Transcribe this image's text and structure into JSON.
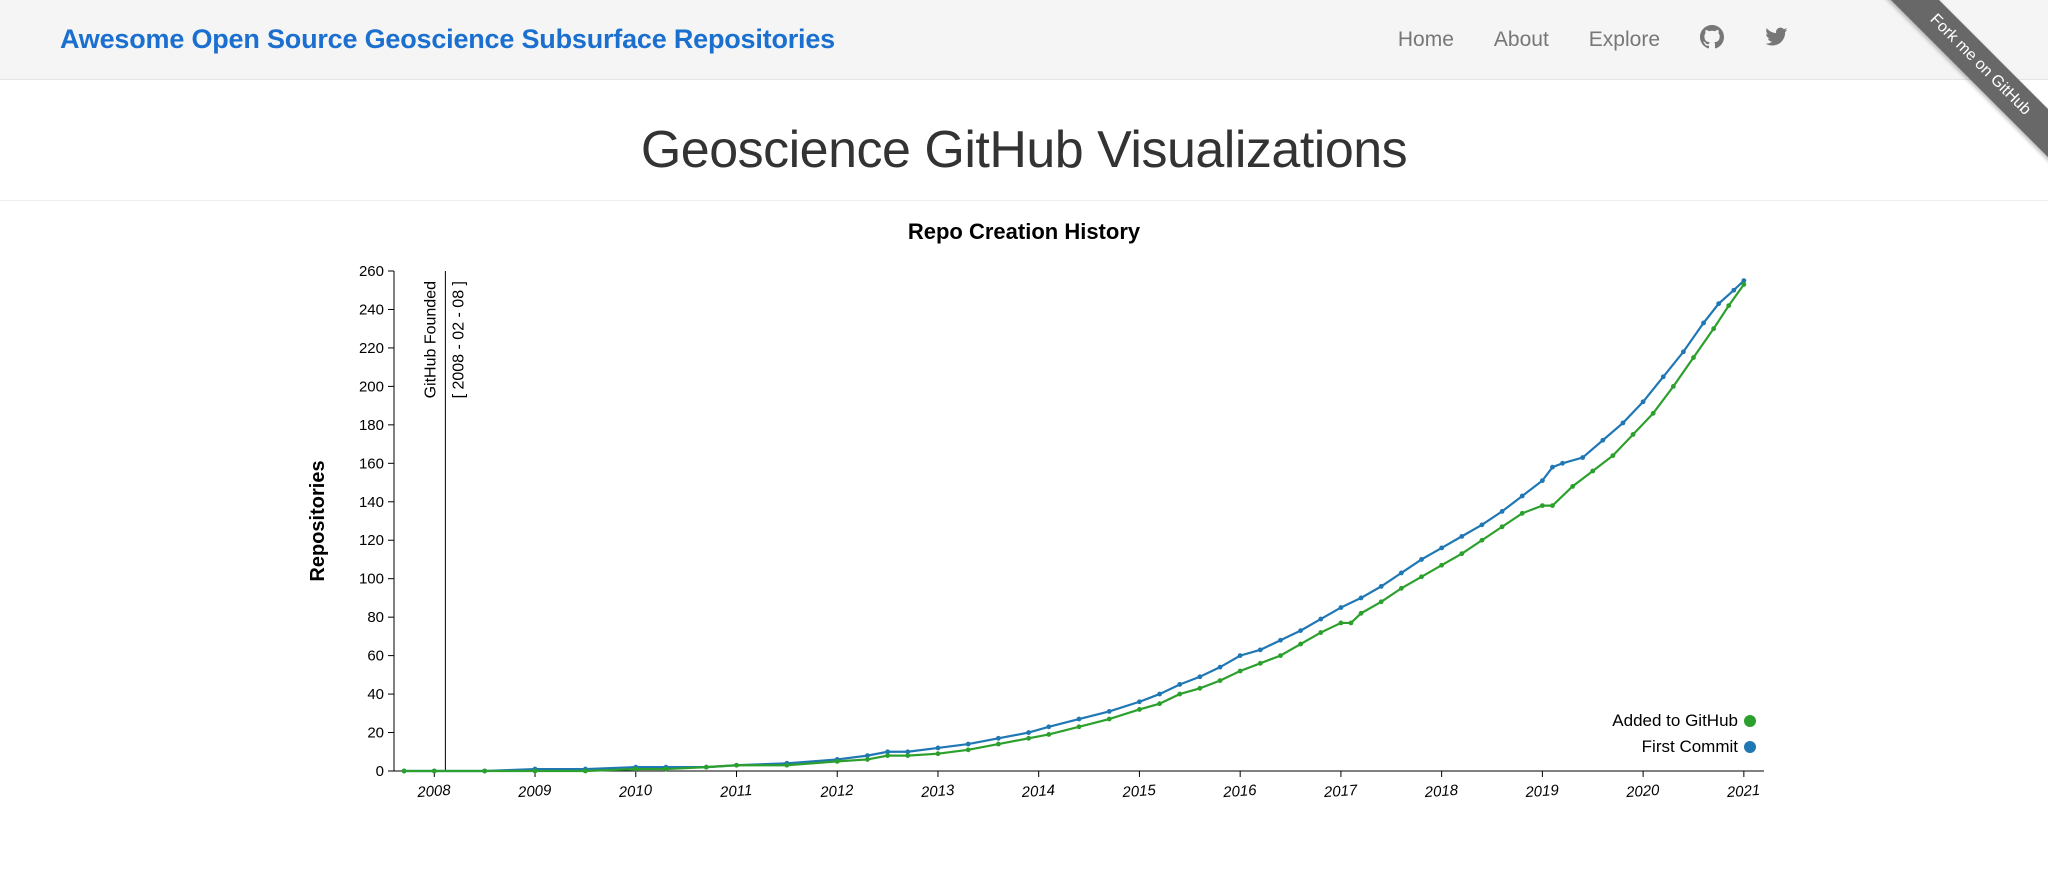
{
  "header": {
    "site_title": "Awesome Open Source Geoscience Subsurface Repositories",
    "nav": {
      "home": "Home",
      "about": "About",
      "explore": "Explore"
    },
    "ribbon": "Fork me on GitHub"
  },
  "page": {
    "title": "Geoscience GitHub Visualizations"
  },
  "chart_data": {
    "type": "line",
    "title": "Repo Creation History",
    "xlabel": "",
    "ylabel": "Repositories",
    "x_range": [
      2007.6,
      2021.2
    ],
    "y_range": [
      0,
      260
    ],
    "x_ticks": [
      2008,
      2009,
      2010,
      2011,
      2012,
      2013,
      2014,
      2015,
      2016,
      2017,
      2018,
      2019,
      2020,
      2021
    ],
    "y_ticks": [
      0,
      20,
      40,
      60,
      80,
      100,
      120,
      140,
      160,
      180,
      200,
      220,
      240,
      260
    ],
    "annotation": {
      "x": 2008.11,
      "label": "GitHub Founded",
      "sublabel": "[ 2008 - 02 - 08 ]"
    },
    "legend": [
      {
        "name": "Added to GitHub",
        "color": "#2ca02c"
      },
      {
        "name": "First Commit",
        "color": "#1f77b4"
      }
    ],
    "series": [
      {
        "name": "First Commit",
        "color": "#1f77b4",
        "points": [
          [
            2007.7,
            0
          ],
          [
            2008.0,
            0
          ],
          [
            2008.5,
            0
          ],
          [
            2009.0,
            1
          ],
          [
            2009.5,
            1
          ],
          [
            2010.0,
            2
          ],
          [
            2010.3,
            2
          ],
          [
            2010.7,
            2
          ],
          [
            2011.0,
            3
          ],
          [
            2011.5,
            4
          ],
          [
            2012.0,
            6
          ],
          [
            2012.3,
            8
          ],
          [
            2012.5,
            10
          ],
          [
            2012.7,
            10
          ],
          [
            2013.0,
            12
          ],
          [
            2013.3,
            14
          ],
          [
            2013.6,
            17
          ],
          [
            2013.9,
            20
          ],
          [
            2014.1,
            23
          ],
          [
            2014.4,
            27
          ],
          [
            2014.7,
            31
          ],
          [
            2015.0,
            36
          ],
          [
            2015.2,
            40
          ],
          [
            2015.4,
            45
          ],
          [
            2015.6,
            49
          ],
          [
            2015.8,
            54
          ],
          [
            2016.0,
            60
          ],
          [
            2016.2,
            63
          ],
          [
            2016.4,
            68
          ],
          [
            2016.6,
            73
          ],
          [
            2016.8,
            79
          ],
          [
            2017.0,
            85
          ],
          [
            2017.2,
            90
          ],
          [
            2017.4,
            96
          ],
          [
            2017.6,
            103
          ],
          [
            2017.8,
            110
          ],
          [
            2018.0,
            116
          ],
          [
            2018.2,
            122
          ],
          [
            2018.4,
            128
          ],
          [
            2018.6,
            135
          ],
          [
            2018.8,
            143
          ],
          [
            2019.0,
            151
          ],
          [
            2019.1,
            158
          ],
          [
            2019.2,
            160
          ],
          [
            2019.4,
            163
          ],
          [
            2019.6,
            172
          ],
          [
            2019.8,
            181
          ],
          [
            2020.0,
            192
          ],
          [
            2020.2,
            205
          ],
          [
            2020.4,
            218
          ],
          [
            2020.6,
            233
          ],
          [
            2020.75,
            243
          ],
          [
            2020.9,
            250
          ],
          [
            2021.0,
            255
          ]
        ]
      },
      {
        "name": "Added to GitHub",
        "color": "#2ca02c",
        "points": [
          [
            2007.7,
            0
          ],
          [
            2008.0,
            0
          ],
          [
            2008.5,
            0
          ],
          [
            2009.0,
            0
          ],
          [
            2009.5,
            0
          ],
          [
            2010.0,
            1
          ],
          [
            2010.3,
            1
          ],
          [
            2010.7,
            2
          ],
          [
            2011.0,
            3
          ],
          [
            2011.5,
            3
          ],
          [
            2012.0,
            5
          ],
          [
            2012.3,
            6
          ],
          [
            2012.5,
            8
          ],
          [
            2012.7,
            8
          ],
          [
            2013.0,
            9
          ],
          [
            2013.3,
            11
          ],
          [
            2013.6,
            14
          ],
          [
            2013.9,
            17
          ],
          [
            2014.1,
            19
          ],
          [
            2014.4,
            23
          ],
          [
            2014.7,
            27
          ],
          [
            2015.0,
            32
          ],
          [
            2015.2,
            35
          ],
          [
            2015.4,
            40
          ],
          [
            2015.6,
            43
          ],
          [
            2015.8,
            47
          ],
          [
            2016.0,
            52
          ],
          [
            2016.2,
            56
          ],
          [
            2016.4,
            60
          ],
          [
            2016.6,
            66
          ],
          [
            2016.8,
            72
          ],
          [
            2017.0,
            77
          ],
          [
            2017.1,
            77
          ],
          [
            2017.2,
            82
          ],
          [
            2017.4,
            88
          ],
          [
            2017.6,
            95
          ],
          [
            2017.8,
            101
          ],
          [
            2018.0,
            107
          ],
          [
            2018.2,
            113
          ],
          [
            2018.4,
            120
          ],
          [
            2018.6,
            127
          ],
          [
            2018.8,
            134
          ],
          [
            2019.0,
            138
          ],
          [
            2019.1,
            138
          ],
          [
            2019.3,
            148
          ],
          [
            2019.5,
            156
          ],
          [
            2019.7,
            164
          ],
          [
            2019.9,
            175
          ],
          [
            2020.1,
            186
          ],
          [
            2020.3,
            200
          ],
          [
            2020.5,
            215
          ],
          [
            2020.7,
            230
          ],
          [
            2020.85,
            242
          ],
          [
            2021.0,
            253
          ]
        ]
      }
    ]
  }
}
